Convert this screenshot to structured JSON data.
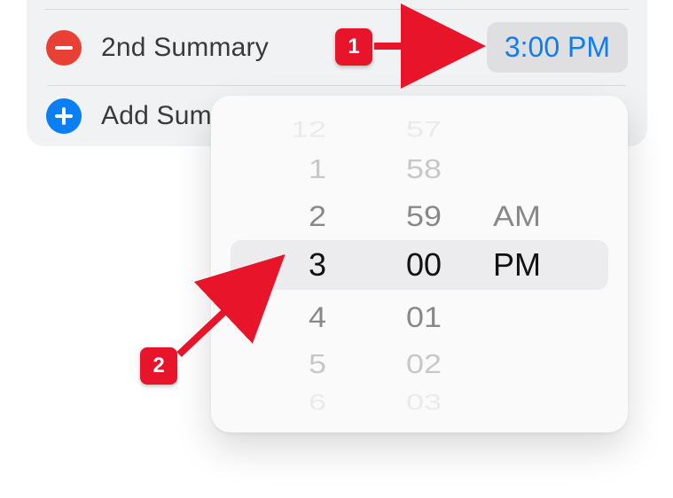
{
  "rows": {
    "removeLabel": "2nd Summary",
    "addLabel": "Add Summary",
    "timeChip": "3:00 PM"
  },
  "picker": {
    "hours": [
      "12",
      "1",
      "2",
      "3",
      "4",
      "5",
      "6"
    ],
    "minutes": [
      "57",
      "58",
      "59",
      "00",
      "01",
      "02",
      "03"
    ],
    "ampm": [
      "AM",
      "PM"
    ]
  },
  "callouts": {
    "first": "1",
    "second": "2"
  }
}
